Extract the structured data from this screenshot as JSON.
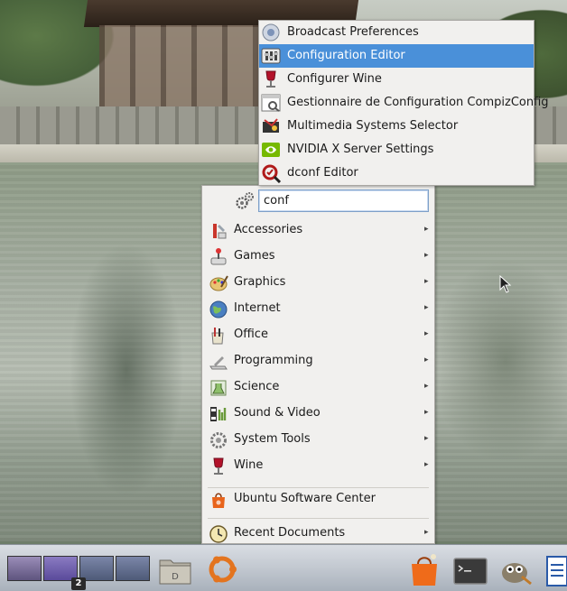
{
  "search": {
    "value": "conf"
  },
  "results": [
    {
      "label": "Broadcast Preferences",
      "icon": "broadcast-icon",
      "active": false
    },
    {
      "label": "Configuration Editor",
      "icon": "configuration-editor-icon",
      "active": true
    },
    {
      "label": "Configurer Wine",
      "icon": "wine-config-icon",
      "active": false
    },
    {
      "label": "Gestionnaire de Configuration CompizConfig",
      "icon": "compizconfig-icon",
      "active": false
    },
    {
      "label": "Multimedia Systems Selector",
      "icon": "multimedia-selector-icon",
      "active": false
    },
    {
      "label": "NVIDIA X Server Settings",
      "icon": "nvidia-icon",
      "active": false
    },
    {
      "label": "dconf Editor",
      "icon": "dconf-editor-icon",
      "active": false
    }
  ],
  "menu": {
    "categories": [
      {
        "label": "Accessories",
        "icon": "accessories-icon"
      },
      {
        "label": "Games",
        "icon": "games-icon"
      },
      {
        "label": "Graphics",
        "icon": "graphics-icon"
      },
      {
        "label": "Internet",
        "icon": "internet-globe-icon"
      },
      {
        "label": "Office",
        "icon": "office-icon"
      },
      {
        "label": "Programming",
        "icon": "programming-icon"
      },
      {
        "label": "Science",
        "icon": "science-icon"
      },
      {
        "label": "Sound & Video",
        "icon": "sound-video-icon"
      },
      {
        "label": "System Tools",
        "icon": "system-tools-icon"
      },
      {
        "label": "Wine",
        "icon": "wine-glass-icon"
      }
    ],
    "software_center": {
      "label": "Ubuntu Software Center",
      "icon": "shopping-bag-icon"
    },
    "recent": {
      "label": "Recent Documents",
      "icon": "clock-icon"
    }
  },
  "taskbar": {
    "workspace_count_badge": "2",
    "colors": {
      "highlight": "#4a90d9"
    }
  }
}
